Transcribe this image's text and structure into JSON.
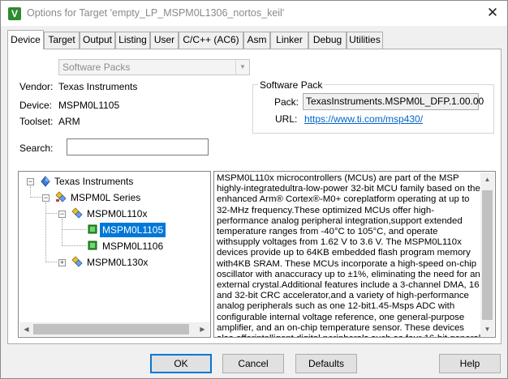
{
  "window": {
    "title": "Options for Target 'empty_LP_MSPM0L1306_nortos_keil'",
    "app_icon_glyph": "V",
    "close_glyph": "✕"
  },
  "tabs": [
    {
      "label": "Device",
      "active": true
    },
    {
      "label": "Target"
    },
    {
      "label": "Output"
    },
    {
      "label": "Listing"
    },
    {
      "label": "User"
    },
    {
      "label": "C/C++ (AC6)"
    },
    {
      "label": "Asm"
    },
    {
      "label": "Linker"
    },
    {
      "label": "Debug"
    },
    {
      "label": "Utilities"
    }
  ],
  "device": {
    "database_select": "Software Packs",
    "vendor_label": "Vendor:",
    "vendor_value": "Texas Instruments",
    "device_label": "Device:",
    "device_value": "MSPM0L1105",
    "toolset_label": "Toolset:",
    "toolset_value": "ARM",
    "search_label": "Search:",
    "search_value": ""
  },
  "software_pack": {
    "legend": "Software Pack",
    "pack_label": "Pack:",
    "pack_value": "TexasInstruments.MSPM0L_DFP.1.00.00",
    "url_label": "URL:",
    "url_value": "https://www.ti.com/msp430/"
  },
  "tree": {
    "nodes": [
      {
        "label": "Texas Instruments",
        "expander": "−",
        "icon": "vendor-diamond-icon"
      },
      {
        "label": "MSPM0L Series",
        "expander": "−",
        "icon": "device-family-icon"
      },
      {
        "label": "MSPM0L110x",
        "expander": "−",
        "icon": "device-subfamily-icon"
      },
      {
        "label": "MSPM0L1105",
        "icon": "chip-icon",
        "selected": true
      },
      {
        "label": "MSPM0L1106",
        "icon": "chip-icon"
      },
      {
        "label": "MSPM0L130x",
        "expander": "+",
        "icon": "device-subfamily-icon"
      }
    ]
  },
  "description": "MSPM0L110x microcontrollers (MCUs) are part of the MSP highly-integratedultra-low-power 32-bit MCU family based on the enhanced Arm® Cortex®-M0+ coreplatform operating at up to 32-MHz frequency.These optimized MCUs offer high-performance analog peripheral integration,support extended temperature ranges from -40°C to 105°C, and operate withsupply voltages from 1.62 V to 3.6 V. The MSPM0L110x devices provide up to 64KB embedded flash program memory with4KB SRAM. These MCUs incorporate a high-speed on-chip oscillator with anaccuracy up to ±1%, eliminating the need for an external crystal.Additional features include a 3-channel DMA, 16 and 32-bit CRC accelerator,and a variety of high-performance analog peripherals such as one 12-bit1.45-Msps ADC with configurable internal voltage reference, one general-purpose amplifier, and an on-chip temperature sensor. These devices also offerintelligent digital peripherals such as four 16-bit general purpose",
  "buttons": {
    "ok": "OK",
    "cancel": "Cancel",
    "defaults": "Defaults",
    "help": "Help"
  },
  "colors": {
    "selection": "#0078d7",
    "link": "#0066cc",
    "default_button_border": "#0078d7"
  }
}
